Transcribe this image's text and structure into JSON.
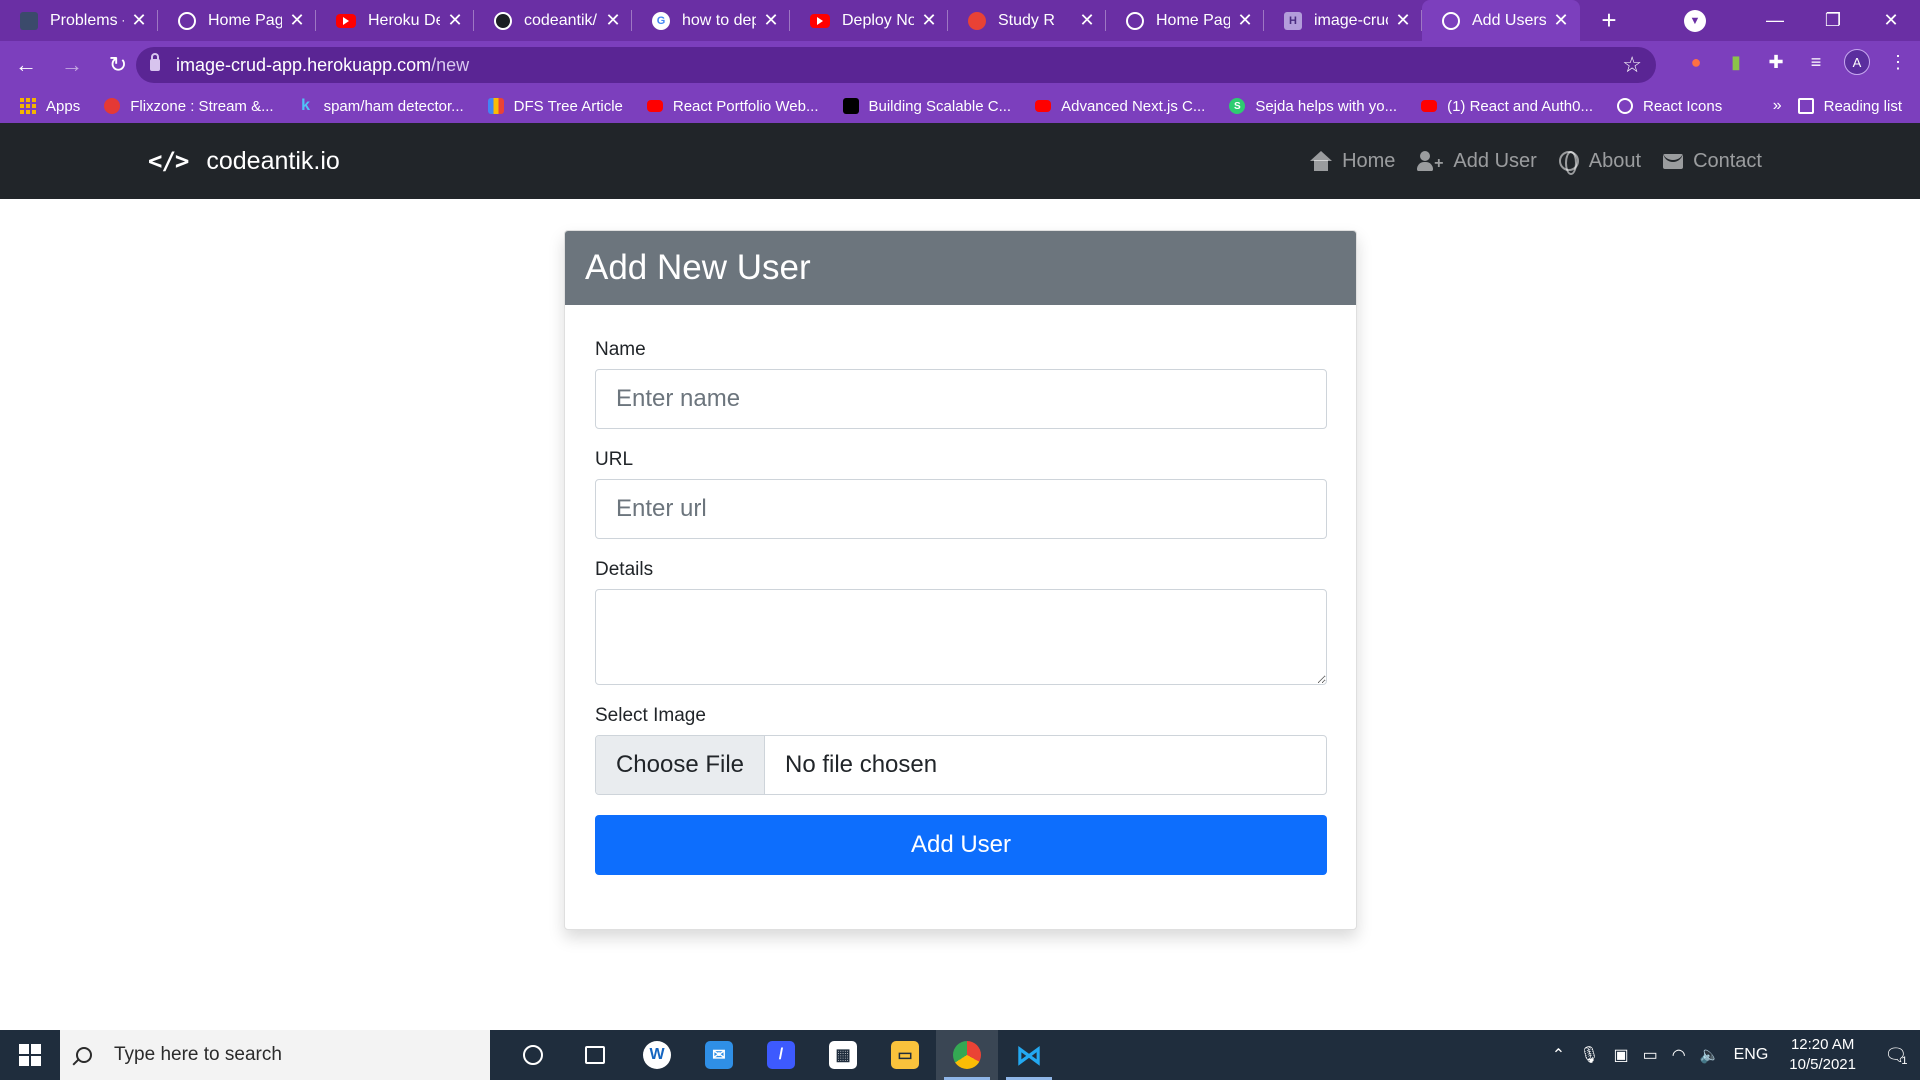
{
  "browser": {
    "tabs": [
      {
        "title": "Problems - ",
        "favicon": "vscode-icon"
      },
      {
        "title": "Home Page",
        "favicon": "globe-icon"
      },
      {
        "title": "Heroku Dep",
        "favicon": "youtube-icon"
      },
      {
        "title": "codeantik/i",
        "favicon": "github-icon"
      },
      {
        "title": "how to dep",
        "favicon": "google-icon"
      },
      {
        "title": "Deploy Noc",
        "favicon": "youtube-icon"
      },
      {
        "title": "Study R",
        "favicon": "google-chrome-icon"
      },
      {
        "title": "Home Page",
        "favicon": "globe-icon"
      },
      {
        "title": "image-cruc",
        "favicon": "heroku-icon"
      },
      {
        "title": "Add Users",
        "favicon": "globe-icon"
      }
    ],
    "active_tab_index": 9,
    "url_host": "image-crud-app.herokuapp.com",
    "url_path": "/new",
    "profile_initial": "A",
    "bookmarks": [
      {
        "label": "Apps",
        "icon": "apps-grid-icon"
      },
      {
        "label": "Flixzone : Stream &...",
        "icon": "flixzone-icon"
      },
      {
        "label": "spam/ham detector...",
        "icon": "kaggle-icon"
      },
      {
        "label": "DFS Tree Article",
        "icon": "bar-chart-icon"
      },
      {
        "label": "React Portfolio Web...",
        "icon": "youtube-icon"
      },
      {
        "label": "Building Scalable C...",
        "icon": "medium-icon"
      },
      {
        "label": "Advanced Next.js C...",
        "icon": "youtube-icon"
      },
      {
        "label": "Sejda helps with yo...",
        "icon": "sejda-icon"
      },
      {
        "label": "(1) React and Auth0...",
        "icon": "youtube-icon"
      },
      {
        "label": "React Icons",
        "icon": "globe-icon"
      }
    ],
    "bookmarks_more": "»",
    "reading_list": "Reading list"
  },
  "navbar": {
    "brand_icon": "</>",
    "brand": "codeantik.io",
    "links": [
      {
        "label": "Home",
        "icon": "home-icon"
      },
      {
        "label": "Add User",
        "icon": "user-plus-icon"
      },
      {
        "label": "About",
        "icon": "globe-icon"
      },
      {
        "label": "Contact",
        "icon": "envelope-icon"
      }
    ]
  },
  "form": {
    "title": "Add New User",
    "name_label": "Name",
    "name_placeholder": "Enter name",
    "url_label": "URL",
    "url_placeholder": "Enter url",
    "details_label": "Details",
    "image_label": "Select Image",
    "file_button": "Choose File",
    "file_status": "No file chosen",
    "submit_label": "Add User"
  },
  "taskbar": {
    "search_placeholder": "Type here to search",
    "language": "ENG",
    "time": "12:20 AM",
    "date": "10/5/2021",
    "notification_count": "1"
  },
  "colors": {
    "browser_frame": "#7c3fbd",
    "navbar": "#212529",
    "card_header": "#6c757d",
    "primary_button": "#0d6efd",
    "taskbar": "#1f2d3d"
  }
}
